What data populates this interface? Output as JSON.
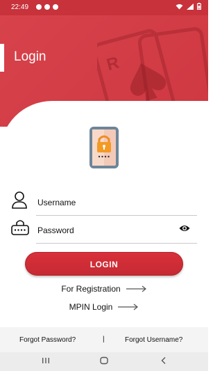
{
  "status_bar": {
    "time": "22:49"
  },
  "header": {
    "title": "Login",
    "card_letter": "R"
  },
  "form": {
    "username_label": "Username",
    "password_label": "Password"
  },
  "login_button": "LOGIN",
  "links": {
    "registration": "For Registration",
    "mpin": "MPIN Login"
  },
  "footer": {
    "forgot_password": "Forgot Password?",
    "separator": "|",
    "forgot_username": "Forgot Username?"
  },
  "colors": {
    "brand_red": "#cf3841",
    "button_red": "#d8303a"
  },
  "icons": [
    "user-icon",
    "lock-keyboard-icon",
    "eye-icon",
    "arrow-right-icon",
    "phone-lock-icon"
  ]
}
